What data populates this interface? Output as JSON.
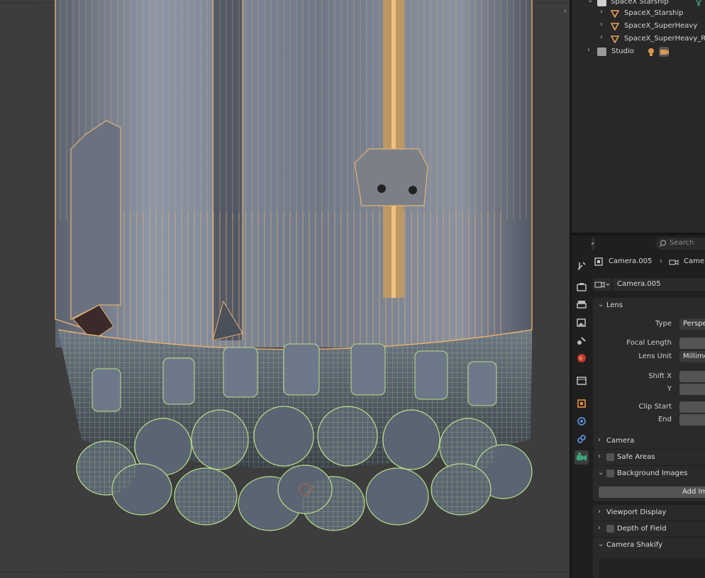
{
  "outliner": {
    "items": [
      {
        "label": "SpaceX Starship",
        "type": "collection"
      },
      {
        "label": "SpaceX_Starship",
        "type": "mesh"
      },
      {
        "label": "SpaceX_SuperHeavy",
        "type": "mesh"
      },
      {
        "label": "SpaceX_SuperHeavy_Ra",
        "type": "mesh"
      },
      {
        "label": "Studio",
        "type": "collection"
      }
    ]
  },
  "properties": {
    "search_placeholder": "Search",
    "breadcrumb": {
      "object": "Camera.005",
      "data": "Came"
    },
    "datablock_name": "Camera.005",
    "lens": {
      "header": "Lens",
      "type_label": "Type",
      "type_value": "Perspe",
      "focal_length_label": "Focal Length",
      "lens_unit_label": "Lens Unit",
      "lens_unit_value": "Millime",
      "shift_x_label": "Shift X",
      "shift_y_label": "Y",
      "clip_start_label": "Clip Start",
      "clip_end_label": "End"
    },
    "panels": {
      "camera": "Camera",
      "safe_areas": "Safe Areas",
      "background_images": "Background Images",
      "add_image": "Add Im",
      "viewport_display": "Viewport Display",
      "depth_of_field": "Depth of Field",
      "camera_shakify": "Camera Shakify"
    }
  },
  "colors": {
    "selection_orange": "#e8b070",
    "wire_green": "#b8e08a",
    "accent_green": "#3fa67a"
  }
}
